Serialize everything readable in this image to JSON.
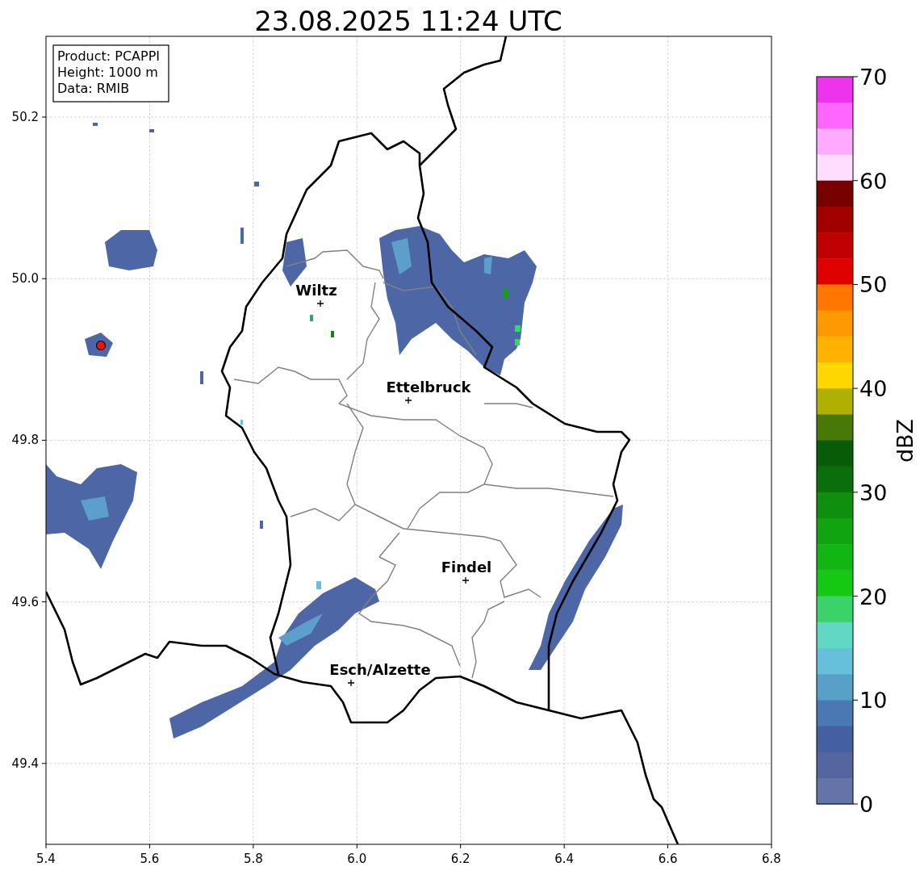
{
  "title": "23.08.2025 11:24 UTC",
  "info_box": [
    "Product: PCAPPI",
    "Height: 1000 m",
    "Data: RMIB"
  ],
  "map": {
    "xticks": [
      "5.4",
      "5.6",
      "5.8",
      "6.0",
      "6.2",
      "6.4",
      "6.6",
      "6.8"
    ],
    "yticks": [
      "50.2",
      "50.0",
      "49.8",
      "49.6",
      "49.4"
    ],
    "places": [
      {
        "name": "Wiltz"
      },
      {
        "name": "Ettelbruck"
      },
      {
        "name": "Findel"
      },
      {
        "name": "Esch/Alzette"
      }
    ],
    "radar_site": {
      "color": "#ee1111"
    }
  },
  "colorbar": {
    "label": "dBZ",
    "ticks": [
      "70",
      "60",
      "50",
      "40",
      "30",
      "20",
      "10",
      "0"
    ],
    "bins": [
      {
        "color": "#ee33ee"
      },
      {
        "color": "#ff66ff"
      },
      {
        "color": "#ffaaff"
      },
      {
        "color": "#ffddff"
      },
      {
        "color": "#770000"
      },
      {
        "color": "#a00000"
      },
      {
        "color": "#c00000"
      },
      {
        "color": "#e00000"
      },
      {
        "color": "#ff7700"
      },
      {
        "color": "#ff9900"
      },
      {
        "color": "#ffb300"
      },
      {
        "color": "#ffd700"
      },
      {
        "color": "#b0b000"
      },
      {
        "color": "#487808"
      },
      {
        "color": "#085c08"
      },
      {
        "color": "#0a6e0a"
      },
      {
        "color": "#0e900e"
      },
      {
        "color": "#10a410"
      },
      {
        "color": "#12b612"
      },
      {
        "color": "#14c814"
      },
      {
        "color": "#3cd26a"
      },
      {
        "color": "#60d8c4"
      },
      {
        "color": "#66c0dc"
      },
      {
        "color": "#58a0c8"
      },
      {
        "color": "#4a78b2"
      },
      {
        "color": "#4460a2"
      },
      {
        "color": "#5466a0"
      },
      {
        "color": "#6474a8"
      }
    ]
  }
}
